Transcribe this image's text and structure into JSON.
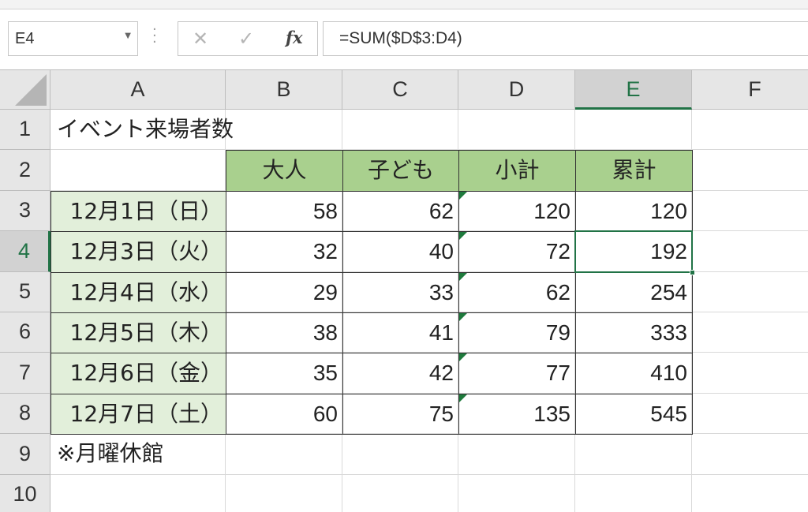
{
  "name_box": {
    "value": "E4"
  },
  "formula_bar": {
    "cancel_icon": "close-icon",
    "enter_icon": "check-icon",
    "fx_label": "fx",
    "formula": "=SUM($D$3:D4)"
  },
  "columns": [
    "A",
    "B",
    "C",
    "D",
    "E",
    "F"
  ],
  "rows": [
    "1",
    "2",
    "3",
    "4",
    "5",
    "6",
    "7",
    "8",
    "9",
    "10"
  ],
  "active_cell": {
    "column": "E",
    "row": "4"
  },
  "sheet": {
    "title": "イベント来場者数",
    "headers": {
      "adult": "大人",
      "child": "子ども",
      "subtotal": "小計",
      "cumulative": "累計"
    },
    "note": "※月曜休館",
    "records": [
      {
        "date": "12月1日（日）",
        "adult": "58",
        "child": "62",
        "subtotal": "120",
        "cumulative": "120"
      },
      {
        "date": "12月3日（火）",
        "adult": "32",
        "child": "40",
        "subtotal": "72",
        "cumulative": "192"
      },
      {
        "date": "12月4日（水）",
        "adult": "29",
        "child": "33",
        "subtotal": "62",
        "cumulative": "254"
      },
      {
        "date": "12月5日（木）",
        "adult": "38",
        "child": "41",
        "subtotal": "79",
        "cumulative": "333"
      },
      {
        "date": "12月6日（金）",
        "adult": "35",
        "child": "42",
        "subtotal": "77",
        "cumulative": "410"
      },
      {
        "date": "12月7日（土）",
        "adult": "60",
        "child": "75",
        "subtotal": "135",
        "cumulative": "545"
      }
    ]
  },
  "colors": {
    "header_fill": "#a9d08e",
    "date_fill": "#e2efda",
    "accent": "#217346"
  }
}
